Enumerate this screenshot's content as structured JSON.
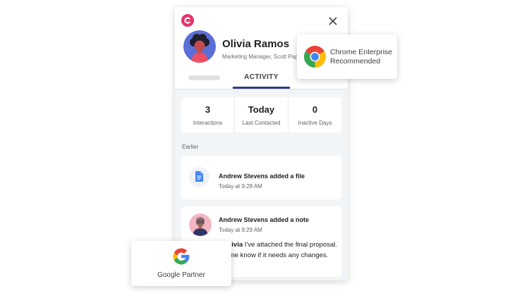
{
  "profile": {
    "name": "Olivia Ramos",
    "role": "Marketing Manager, Scott Paper"
  },
  "tabs": {
    "active_label": "ACTIVITY"
  },
  "stats": [
    {
      "value": "3",
      "label": "Interactions"
    },
    {
      "value": "Today",
      "label": "Last Contacted"
    },
    {
      "value": "0",
      "label": "Inactive Days"
    }
  ],
  "feed": {
    "section_label": "Earlier",
    "items": [
      {
        "title": "Andrew Stevens added a file",
        "time": "Today at 9:28 AM"
      },
      {
        "title": "Andrew Stevens added a note",
        "time": "Today at 9:29 AM",
        "mention": "@Olivia",
        "note_line1": " I've attached the final proposal.",
        "note_line2": "Let me know if it needs any changes."
      }
    ]
  },
  "badges": {
    "chrome_line1": "Chrome Enterprise",
    "chrome_line2": "Recommended",
    "google_text": "Google Partner"
  },
  "icons": {
    "app_logo": "copper-logo-icon",
    "close": "close-icon",
    "file": "google-docs-icon",
    "chrome": "chrome-icon",
    "google": "google-g-icon"
  },
  "colors": {
    "tab_underline": "#2f3a8f",
    "app_logo": "#e8336d",
    "doc_blue": "#4285f4"
  }
}
